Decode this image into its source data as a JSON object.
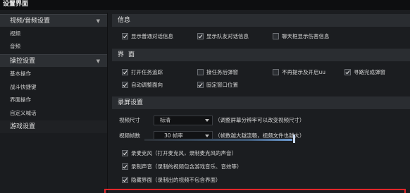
{
  "window": {
    "title": "设置界面"
  },
  "sidebar": {
    "groups": [
      {
        "label": "视频/音频设置",
        "items": [
          "视频",
          "音频"
        ]
      },
      {
        "label": "操控设置",
        "items": [
          "基本操作",
          "战斗快捷键",
          "界面操作",
          "自定义喊话"
        ]
      },
      {
        "label": "游戏设置",
        "items": []
      }
    ]
  },
  "sections": {
    "info": {
      "title": "信息",
      "options": [
        {
          "label": "显示普通对话信息",
          "checked": true
        },
        {
          "label": "显示队友对话信息",
          "checked": true
        },
        {
          "label": "聊天框显示伤害信息",
          "checked": false
        }
      ]
    },
    "ui": {
      "title": "界面",
      "options": [
        {
          "label": "打开任务追踪",
          "checked": true
        },
        {
          "label": "接任务后弹窗",
          "checked": false
        },
        {
          "label": "不再提示及开启uu",
          "checked": false
        },
        {
          "label": "寻路完成弹窗",
          "checked": true
        },
        {
          "label": "自动调整面向",
          "checked": true
        },
        {
          "label": "固定窗口位置",
          "checked": true
        }
      ]
    },
    "record": {
      "title": "录屏设置",
      "video_size_label": "视频尺寸",
      "video_size_value": "标清",
      "video_size_hint": "（调整屏幕分辨率可以改变视频尺寸）",
      "fps_label": "视频帧数",
      "fps_value": "30 帧率",
      "fps_hint": "（帧数越大越流畅，视频文件也越大）",
      "options": [
        {
          "label": "录麦克风（打开麦克风，录制麦克风的声音）",
          "checked": true
        },
        {
          "label": "录制声音（录制的视频包含游戏音乐、音效等）",
          "checked": true
        },
        {
          "label": "隐藏界面（录制出的视频不包含界面）",
          "checked": true
        }
      ],
      "mic_volume": 1.0
    }
  },
  "colors": {
    "highlight_border": "#e0262a",
    "slider_accent": "#6d9bd2"
  }
}
